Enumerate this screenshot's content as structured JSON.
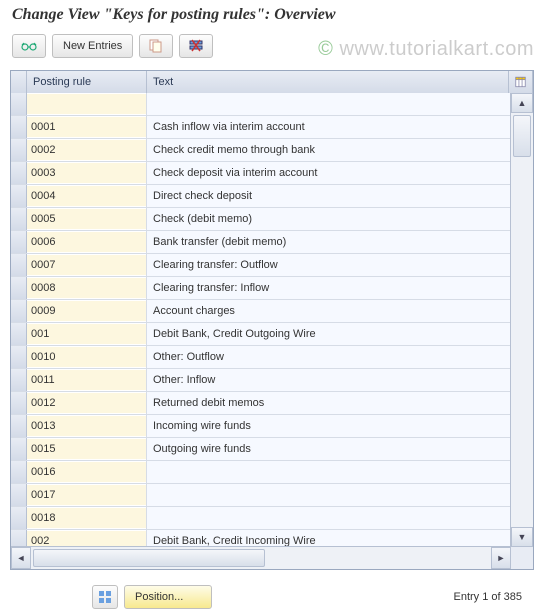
{
  "title": "Change View \"Keys for posting rules\": Overview",
  "watermark_prefix": "www.tutorialkart.c",
  "watermark_suffix": "o",
  "watermark_end": "m",
  "toolbar": {
    "new_entries_label": "New Entries"
  },
  "grid": {
    "columns": {
      "rule": "Posting rule",
      "text": "Text"
    },
    "rows": [
      {
        "rule": "",
        "text": ""
      },
      {
        "rule": "0001",
        "text": "Cash inflow via interim account"
      },
      {
        "rule": "0002",
        "text": "Check credit memo through bank"
      },
      {
        "rule": "0003",
        "text": "Check deposit via interim account"
      },
      {
        "rule": "0004",
        "text": "Direct check deposit"
      },
      {
        "rule": "0005",
        "text": "Check (debit memo)"
      },
      {
        "rule": "0006",
        "text": "Bank transfer (debit memo)"
      },
      {
        "rule": "0007",
        "text": "Clearing transfer: Outflow"
      },
      {
        "rule": "0008",
        "text": "Clearing transfer: Inflow"
      },
      {
        "rule": "0009",
        "text": "Account charges"
      },
      {
        "rule": "001",
        "text": "Debit Bank, Credit Outgoing Wire"
      },
      {
        "rule": "0010",
        "text": "Other: Outflow"
      },
      {
        "rule": "0011",
        "text": "Other: Inflow"
      },
      {
        "rule": "0012",
        "text": "Returned debit memos"
      },
      {
        "rule": "0013",
        "text": "Incoming wire funds"
      },
      {
        "rule": "0015",
        "text": "Outgoing wire funds"
      },
      {
        "rule": "0016",
        "text": ""
      },
      {
        "rule": "0017",
        "text": ""
      },
      {
        "rule": "0018",
        "text": ""
      },
      {
        "rule": "002",
        "text": "Debit Bank, Credit Incoming Wire"
      }
    ]
  },
  "footer": {
    "position_label": "Position...",
    "entry_label": "Entry 1 of 385"
  }
}
